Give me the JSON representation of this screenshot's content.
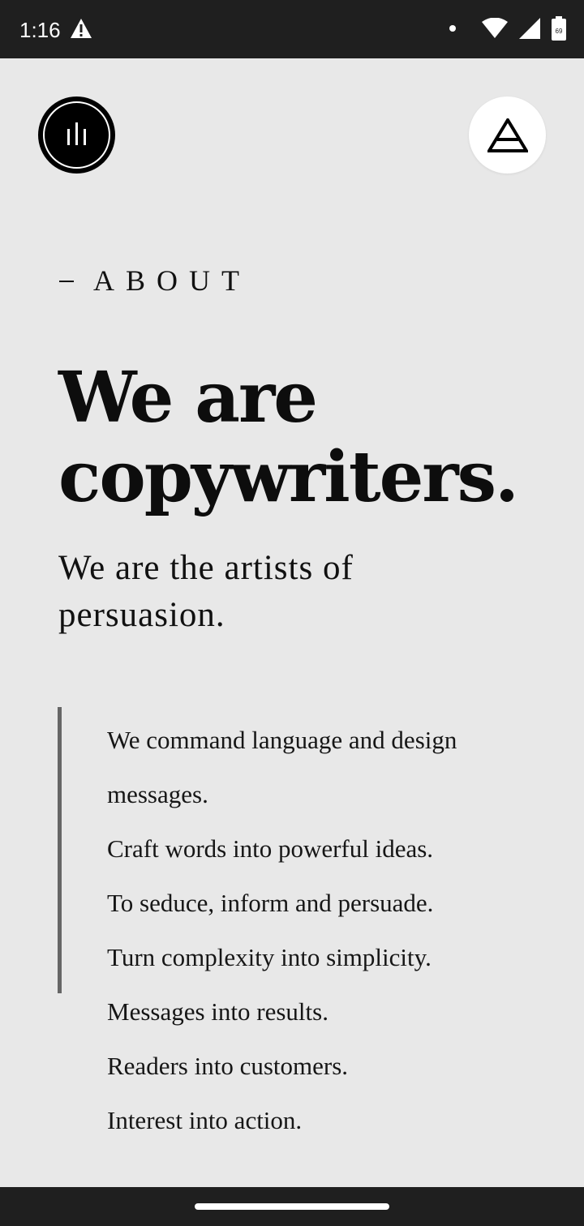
{
  "status_bar": {
    "time": "1:16",
    "icons": [
      "warning-icon",
      "notification-dot-icon",
      "wifi-icon",
      "cell-signal-icon",
      "battery-icon"
    ],
    "battery_level": "69"
  },
  "header": {
    "logo_icon": "brand-logo-icon",
    "menu_icon": "triangle-menu-icon"
  },
  "about": {
    "label": "ABOUT"
  },
  "main": {
    "heading_line1": "We are",
    "heading_line2": "copywriters.",
    "subheading": "We are the artists of persuasion.",
    "lines": [
      "We command language and design",
      "messages.",
      "Craft words into powerful ideas.",
      "To seduce, inform and persuade.",
      "Turn complexity into simplicity.",
      "Messages into results.",
      "Readers into customers.",
      "Interest into action."
    ]
  },
  "colors": {
    "background": "#e8e8e8",
    "status_bar": "#1f1f1f",
    "accent_bar": "#666666",
    "text": "#111111"
  }
}
